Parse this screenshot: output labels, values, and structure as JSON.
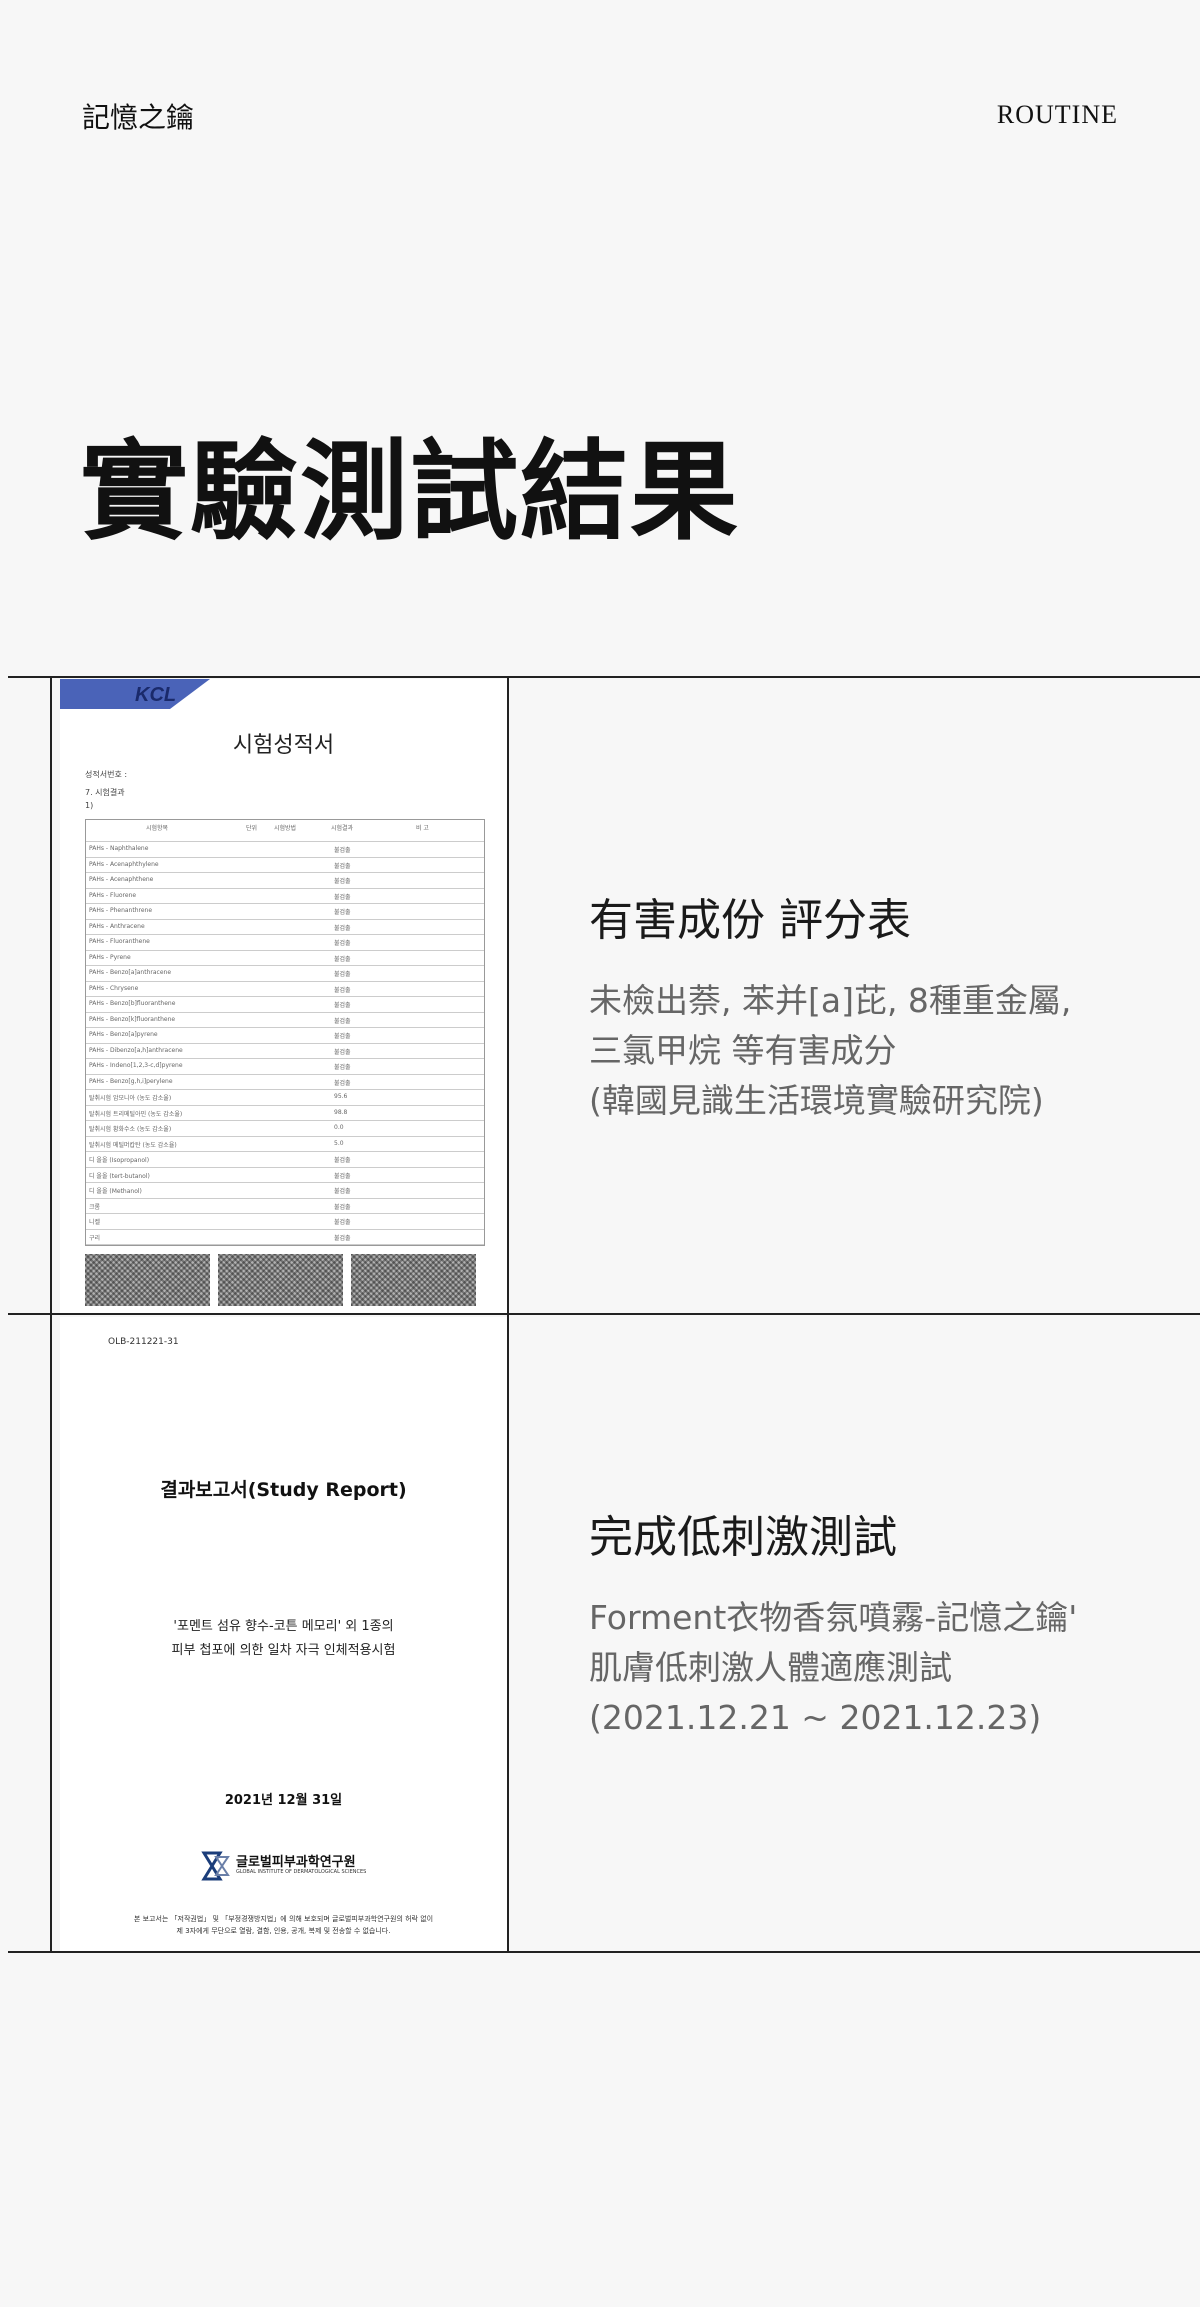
{
  "header": {
    "brand": "記憶之鑰",
    "nav": "ROUTINE"
  },
  "page_title": "實驗測試結果",
  "rows": [
    {
      "title": "有害成份 評分表",
      "desc": [
        "未檢出萘, 苯并[a]芘, 8種重金屬,",
        "三氯甲烷 等有害成分",
        "(韓國見識生活環境實驗研究院)"
      ],
      "document": {
        "heading": "시험성적서",
        "line1": "성적서번호 :",
        "line2": "7. 시험결과",
        "line3": "1)",
        "col_item": "시험항목",
        "col_unit": "단위",
        "col_method": "시험방법",
        "col_result": "시험결과",
        "col_note": "비 고",
        "items": [
          "PAHs - Naphthalene",
          "PAHs - Acenaphthylene",
          "PAHs - Acenaphthene",
          "PAHs - Fluorene",
          "PAHs - Phenanthrene",
          "PAHs - Anthracene",
          "PAHs - Fluoranthene",
          "PAHs - Pyrene",
          "PAHs - Benzo[a]anthracene",
          "PAHs - Chrysene",
          "PAHs - Benzo[b]fluoranthene",
          "PAHs - Benzo[k]fluoranthene",
          "PAHs - Benzo[a]pyrene",
          "PAHs - Dibenzo[a,h]anthracene",
          "PAHs - Indeno[1,2,3-c,d]pyrene",
          "PAHs - Benzo[g,h,i]perylene",
          "탈취시험 암모니아 (농도 감소율)",
          "탈취시험 트리메틸아민 (농도 감소율)",
          "탈취시험 황화수소 (농도 감소율)",
          "탈취시험 메틸머캅탄 (농도 감소율)",
          "디 올올 (Isopropanol)",
          "디 올올 (tert-butanol)",
          "디 올올 (Methanol)",
          "크롬",
          "니켈",
          "구리"
        ],
        "results": [
          "불검출",
          "불검출",
          "불검출",
          "불검출",
          "불검출",
          "불검출",
          "불검출",
          "불검출",
          "불검출",
          "불검출",
          "불검출",
          "불검출",
          "불검출",
          "불검출",
          "불검출",
          "불검출",
          "95.6",
          "98.8",
          "0.0",
          "5.0",
          "불검출",
          "불검출",
          "불검출",
          "불검출",
          "불검출",
          "불검출"
        ]
      }
    },
    {
      "title": "完成低刺激測試",
      "desc": [
        "Forment衣物香氛噴霧-記憶之鑰'",
        "肌膚低刺激人體適應測試",
        "(2021.12.21 ~ 2021.12.23)"
      ],
      "report": {
        "code": "OLB-211221-31",
        "title": "결과보고서(Study Report)",
        "sub1": "'포멘트 섬유 향수-코튼 메모리' 외 1종의",
        "sub2": "피부 첩포에 의한 일차 자극 인체적용시험",
        "date": "2021년 12월 31일",
        "logo_text": "글로벌피부과학연구원",
        "logo_sub": "GLOBAL INSTITUTE OF DERMATOLOGICAL SCIENCES",
        "foot1": "본 보고서는 「저작권법」 및 「부정경쟁방지법」에 의해 보호되며 글로벌피부과학연구원의 허락 없이",
        "foot2": "제 3자에게 무단으로 열람, 결함, 인용, 공개, 복제 및 전송할 수 없습니다."
      }
    }
  ],
  "colors": {
    "background": "#f7f7f7",
    "line": "#222222",
    "desc_text": "#666666"
  }
}
